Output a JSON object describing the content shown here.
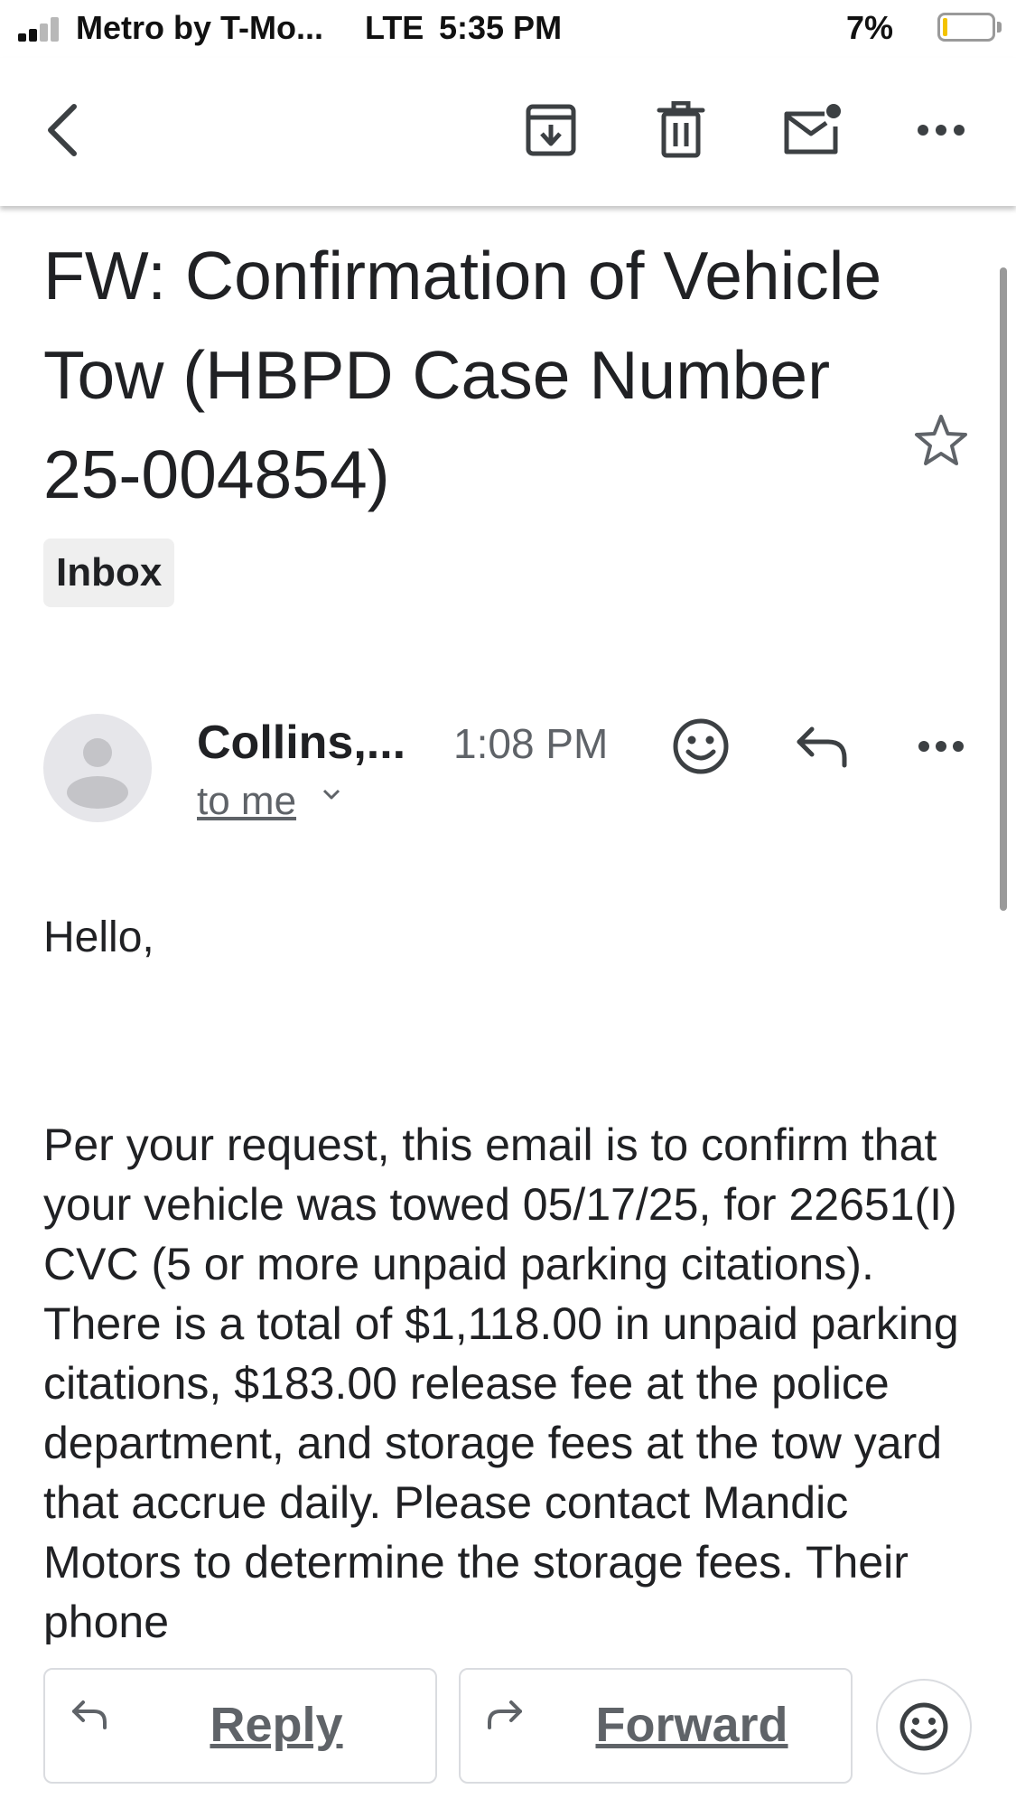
{
  "status_bar": {
    "carrier": "Metro by T-Mo...",
    "network": "LTE",
    "time": "5:35 PM",
    "battery_percent": "7%",
    "battery_level": 0.07,
    "signal_bars": 2
  },
  "toolbar": {
    "back_icon": "back-arrow-icon",
    "archive_icon": "archive-icon",
    "delete_icon": "trash-icon",
    "mark_unread_icon": "mark-unread-icon",
    "more_icon": "more-horizontal-icon"
  },
  "email": {
    "subject": "FW: Confirmation of Vehicle Tow (HBPD Case Number 25-004854)",
    "label": "Inbox",
    "starred": false,
    "sender": "Collins,...",
    "time": "1:08 PM",
    "recipient": "to me",
    "greeting": "Hello,",
    "body": "Per your request, this email is to confirm that your vehicle was towed 05/17/25, for 22651(I) CVC (5 or more unpaid parking citations). There is a total of $1,118.00 in unpaid parking citations, $183.00 release fee at the police department, and storage fees at the tow yard that accrue daily. Please contact Mandic Motors to determine the storage fees. Their phone"
  },
  "actions": {
    "reply_label": "Reply",
    "forward_label": "Forward"
  },
  "colors": {
    "text": "#202124",
    "secondary": "#5f6368",
    "border": "#dadce0",
    "battery_fill": "#f3c300"
  }
}
